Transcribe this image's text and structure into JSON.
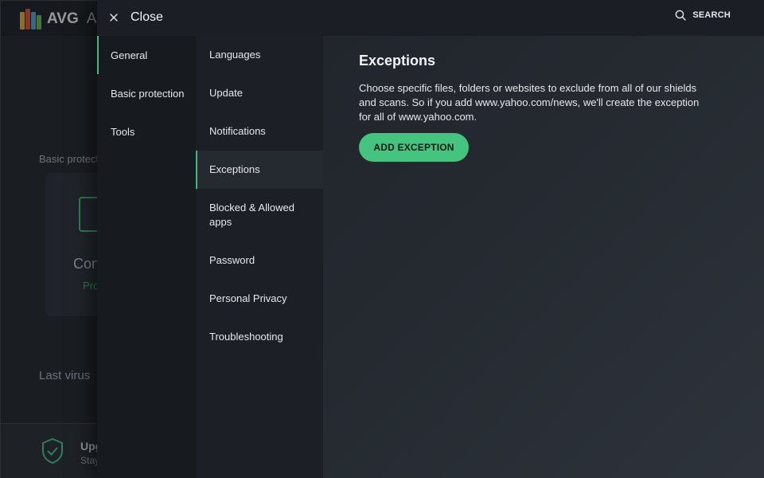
{
  "background": {
    "logo_text": "AVG",
    "logo_subtext": "An",
    "section_label": "Basic protect",
    "card_title": "Con",
    "card_subtitle": "Pro",
    "last_virus_label": "Last virus",
    "upgrade_title": "Upg",
    "upgrade_subtitle": "Stay"
  },
  "header": {
    "close_label": "Close",
    "search_label": "SEARCH",
    "close_icon": "close-icon",
    "search_icon": "search-icon"
  },
  "nav_primary": {
    "items": [
      {
        "label": "General",
        "active": true
      },
      {
        "label": "Basic protection",
        "active": false
      },
      {
        "label": "Tools",
        "active": false
      }
    ]
  },
  "nav_secondary": {
    "items": [
      {
        "label": "Languages",
        "active": false
      },
      {
        "label": "Update",
        "active": false
      },
      {
        "label": "Notifications",
        "active": false
      },
      {
        "label": "Exceptions",
        "active": true
      },
      {
        "label": "Blocked & Allowed apps",
        "active": false
      },
      {
        "label": "Password",
        "active": false
      },
      {
        "label": "Personal Privacy",
        "active": false
      },
      {
        "label": "Troubleshooting",
        "active": false
      }
    ]
  },
  "content": {
    "title": "Exceptions",
    "description": "Choose specific files, folders or websites to exclude from all of our shields and scans. So if you add www.yahoo.com/news, we'll create the exception for all of www.yahoo.com.",
    "add_button_label": "ADD EXCEPTION"
  },
  "colors": {
    "accent": "#45c47f",
    "active_indicator": "#3dbb7a",
    "panel_bg": "#1e2229",
    "nav_primary_bg": "#171a1f",
    "nav_secondary_bg": "#1c2026"
  }
}
